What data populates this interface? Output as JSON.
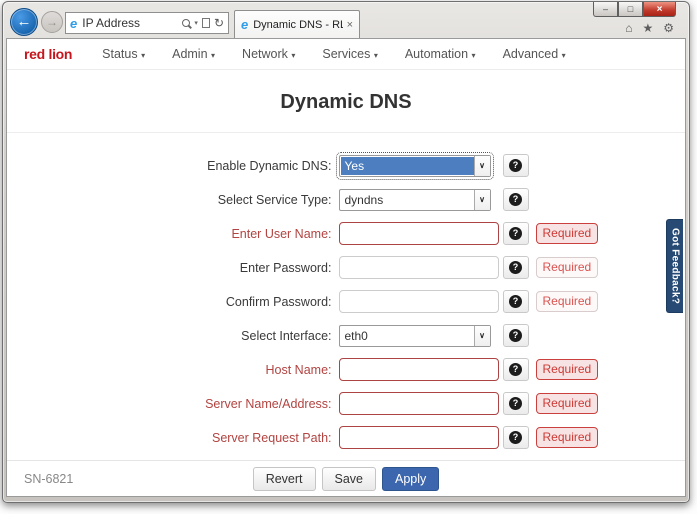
{
  "browser": {
    "address": "IP Address",
    "tab_title": "Dynamic DNS - RLC Admin..."
  },
  "icons": {
    "back_arrow": "←",
    "forward_arrow": "→",
    "ie_logo": "e",
    "dropdown_caret": "▾",
    "refresh": "↻",
    "home": "⌂",
    "favorites": "★",
    "tools": "⚙",
    "minimize": "–",
    "maximize": "□",
    "close": "×",
    "tab_close": "×",
    "select_caret": "∨",
    "nav_caret": "▾"
  },
  "nav": {
    "logo": "red lion",
    "items": [
      "Status",
      "Admin",
      "Network",
      "Services",
      "Automation",
      "Advanced"
    ]
  },
  "page": {
    "title": "Dynamic DNS"
  },
  "form": {
    "help_glyph": "?",
    "required_label": "Required",
    "rows": [
      {
        "id": "enable-dynamic-dns",
        "label": "Enable Dynamic DNS:",
        "type": "select",
        "value": "Yes",
        "focused": true,
        "error": false,
        "required": false
      },
      {
        "id": "service-type",
        "label": "Select Service Type:",
        "type": "select",
        "value": "dyndns",
        "focused": false,
        "error": false,
        "required": false
      },
      {
        "id": "user-name",
        "label": "Enter User Name:",
        "type": "text",
        "value": "",
        "focused": false,
        "error": true,
        "required": true
      },
      {
        "id": "password",
        "label": "Enter Password:",
        "type": "password",
        "value": "",
        "focused": false,
        "error": false,
        "required": true
      },
      {
        "id": "confirm-password",
        "label": "Confirm Password:",
        "type": "password",
        "value": "",
        "focused": false,
        "error": false,
        "required": true
      },
      {
        "id": "interface",
        "label": "Select Interface:",
        "type": "select",
        "value": "eth0",
        "focused": false,
        "error": false,
        "required": false
      },
      {
        "id": "host-name",
        "label": "Host Name:",
        "type": "text",
        "value": "",
        "focused": false,
        "error": true,
        "required": true
      },
      {
        "id": "server-name-address",
        "label": "Server Name/Address:",
        "type": "text",
        "value": "",
        "focused": false,
        "error": true,
        "required": true
      },
      {
        "id": "server-request-path",
        "label": "Server Request Path:",
        "type": "text",
        "value": "",
        "focused": false,
        "error": true,
        "required": true
      }
    ]
  },
  "footer": {
    "serial": "SN-6821",
    "buttons": [
      {
        "label": "Revert",
        "primary": false
      },
      {
        "label": "Save",
        "primary": false
      },
      {
        "label": "Apply",
        "primary": true
      }
    ]
  },
  "feedback": {
    "label": "Got Feedback?"
  }
}
